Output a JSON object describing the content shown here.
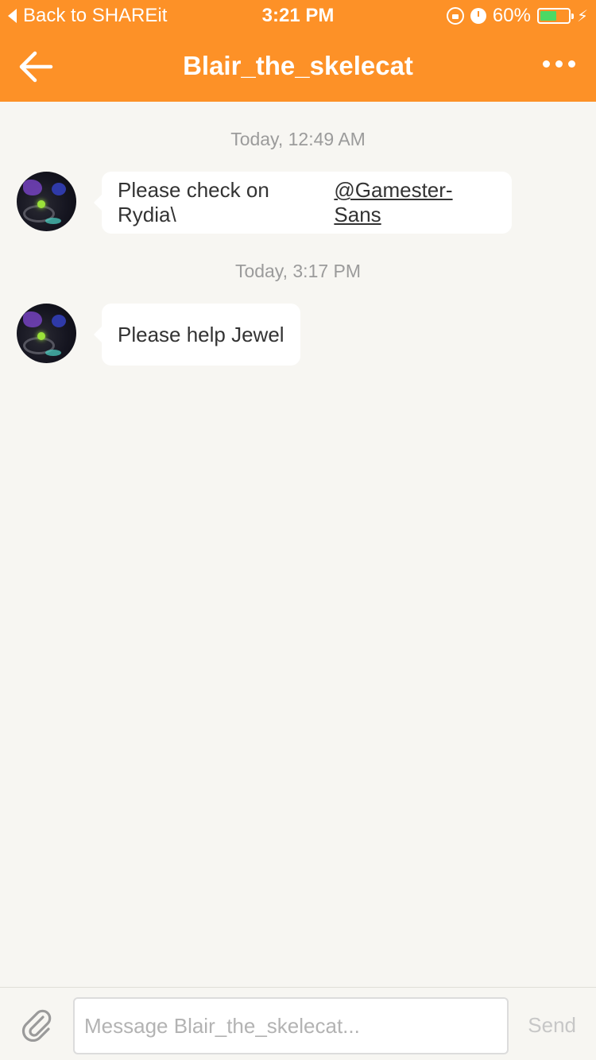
{
  "status_bar": {
    "back_label": "Back to SHAREit",
    "time": "3:21 PM",
    "battery_percent_label": "60%",
    "battery_level": 0.6,
    "battery_color": "#4cd964"
  },
  "nav": {
    "title": "Blair_the_skelecat",
    "back_icon": "arrow-left-icon",
    "more_icon": "ellipsis-icon",
    "bar_color": "#fd9127"
  },
  "messages": [
    {
      "timestamp": "Today, 12:49 AM",
      "text": "Please check on Rydia\\",
      "mention": "@Gamester-Sans"
    },
    {
      "timestamp": "Today, 3:17 PM",
      "text": "Please help Jewel"
    }
  ],
  "composer": {
    "attach_icon": "paperclip-icon",
    "placeholder": "Message Blair_the_skelecat...",
    "value": "",
    "send_label": "Send"
  }
}
